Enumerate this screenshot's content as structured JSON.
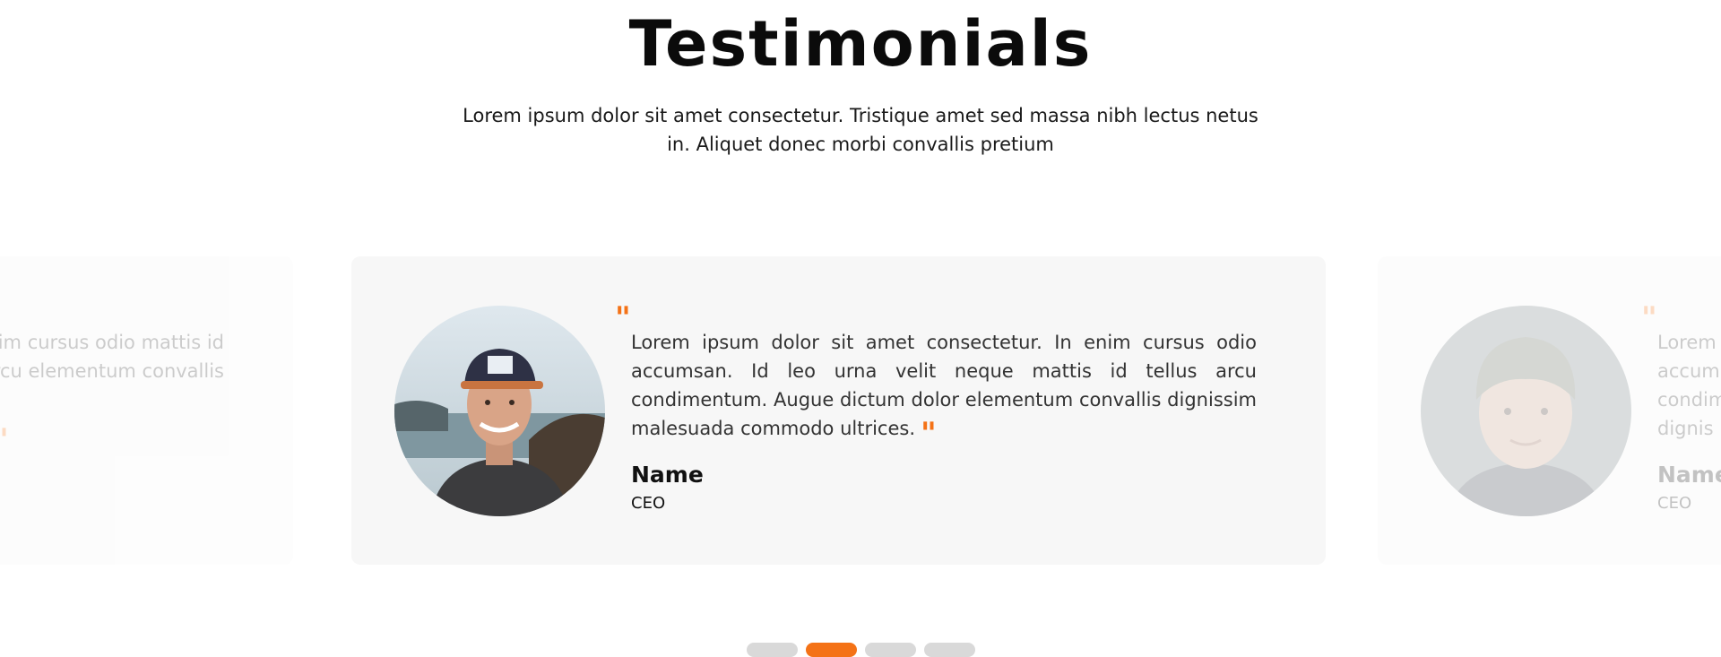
{
  "header": {
    "title": "Testimonials",
    "description": "Lorem ipsum dolor sit amet consectetur. Tristique amet sed massa nibh lectus netus in. Aliquet donec morbi convallis pretium"
  },
  "carousel": {
    "active_index": 1,
    "slides": [
      {
        "quote": "Lorem ipsum dolor sit amet consectetur. In enim cursus odio accumsan. Id leo urna velit neque mattis id tellus arcu condimentum. Augue dictum dolor elementum convallis",
        "visible_fragment": "ur. In enim cursus odio mattis id tellus arcu elementum convallis"
      },
      {
        "quote": "Lorem ipsum dolor sit amet consectetur. In enim cursus odio accumsan. Id leo urna velit neque mattis id tellus arcu condimentum. Augue dictum dolor elementum convallis dignissim malesuada commodo ultrices.",
        "name": "Name",
        "role": "CEO",
        "avatar_icon": "man-in-cap-photo"
      },
      {
        "quote": "Lorem accum condim dignis",
        "name": "Name",
        "role": "CEO",
        "avatar_icon": "young-man-beanie-photo"
      }
    ],
    "pagination_count": 4
  },
  "colors": {
    "accent": "#f47216",
    "card_background": "#f7f7f7",
    "dot_inactive": "#d9d9d9"
  }
}
